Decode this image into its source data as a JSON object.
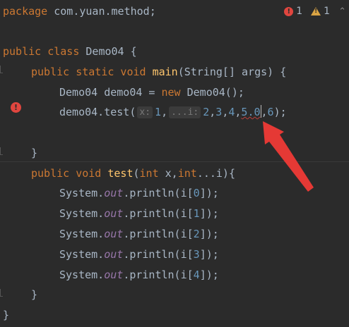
{
  "status": {
    "error_count": "1",
    "warning_count": "1"
  },
  "code": {
    "l1_kw": "package",
    "l1_rest": " com.yuan.method;",
    "l3_kw1": "public class",
    "l3_rest": " Demo04 {",
    "l4_kw": "public static void",
    "l4_fn": "main",
    "l4_rest": "(String[] args) {",
    "l5_a": "Demo04 demo04 = ",
    "l5_kw": "new",
    "l5_b": " Demo04();",
    "l6_a": "demo04.test(",
    "l6_hint_x": "x:",
    "l6_n1": "1",
    "l6_comma1": ",",
    "l6_hint_i": "...i:",
    "l6_n2": "2",
    "l6_c2": ",",
    "l6_n3": "3",
    "l6_c3": ",",
    "l6_n4": "4",
    "l6_c4": ",",
    "l6_n5a": "5.0",
    "l6_c5": ",",
    "l6_n6": "6",
    "l6_end": ");",
    "l8": "}",
    "l9_kw1": "public void",
    "l9_fn": "test",
    "l9_a": "(",
    "l9_kw2": "int",
    "l9_b": " x,",
    "l9_kw3": "int",
    "l9_c": "...i){",
    "println_prefix": "System.",
    "println_field": "out",
    "println_suffix": ".println(i[",
    "println_close": "]);",
    "idx0": "0",
    "idx1": "1",
    "idx2": "2",
    "idx3": "3",
    "idx4": "4",
    "l15": "}",
    "l16": "}"
  },
  "colors": {
    "background": "#2b2b2b",
    "keyword": "#cc7832",
    "function": "#ffc66d",
    "number": "#6897bb",
    "field": "#9876aa",
    "error": "#e0463f",
    "annotation_arrow": "#e53935"
  },
  "icons": {
    "error": "error-icon",
    "warning": "warning-icon",
    "chevron": "chevron-up-icon"
  }
}
